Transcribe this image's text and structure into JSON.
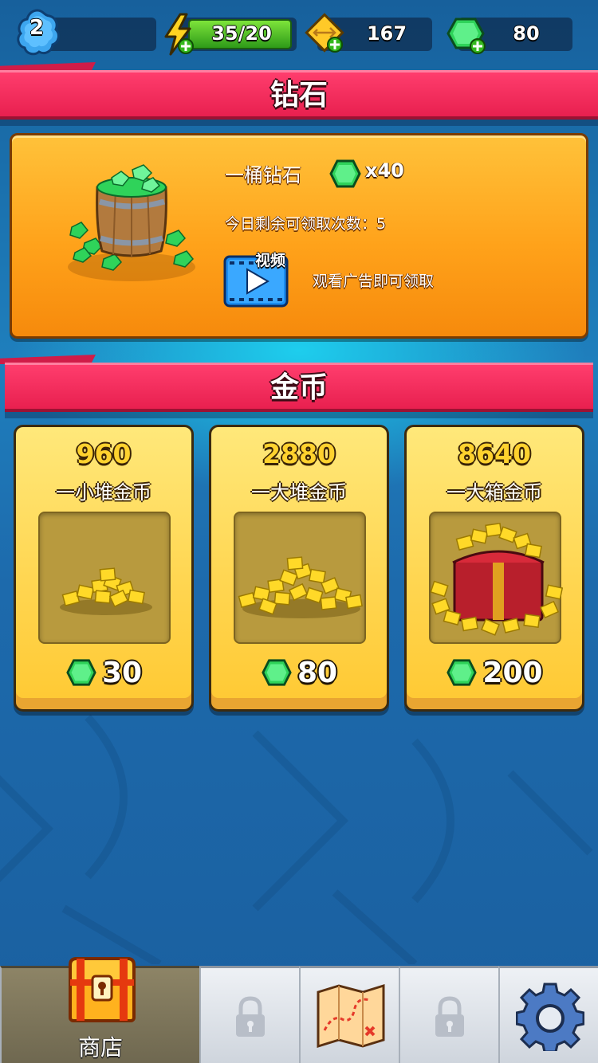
{
  "topbar": {
    "level": "2",
    "energy": "35/20",
    "arrows": "167",
    "gems": "80"
  },
  "diamond_section": {
    "title": "钻石",
    "offer": {
      "name": "一桶钻石",
      "quantity": "x40",
      "remaining": "今日剩余可领取次数：5",
      "video_badge": "视频",
      "hint": "观看广告即可领取"
    }
  },
  "coin_section": {
    "title": "金币",
    "packs": [
      {
        "amount": "960",
        "name": "一小堆金币",
        "price": "30"
      },
      {
        "amount": "2880",
        "name": "一大堆金币",
        "price": "80"
      },
      {
        "amount": "8640",
        "name": "一大箱金币",
        "price": "200"
      }
    ]
  },
  "bottom_nav": {
    "shop_label": "商店"
  },
  "colors": {
    "banner": "#e8204f",
    "offer_card": "#ffa21a",
    "coin_card": "#ffd44d",
    "gem": "#2fd35a",
    "energy_bar": "#4cc22a"
  },
  "icons": [
    "level-badge-icon",
    "energy-bolt-icon",
    "arrow-token-icon",
    "gem-icon",
    "video-play-icon",
    "treasure-chest-icon",
    "lock-icon",
    "treasure-map-icon",
    "gear-icon"
  ]
}
